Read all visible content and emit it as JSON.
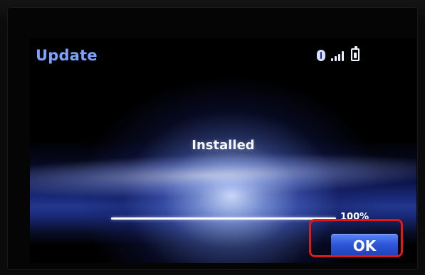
{
  "screen": {
    "title": "Update",
    "status": {
      "bluetooth_icon": "bluetooth-icon",
      "signal_icon": "signal-strength-icon",
      "battery_icon": "battery-icon"
    },
    "message": "Installed",
    "progress": {
      "value": 100,
      "label": "100%"
    },
    "actions": {
      "ok_label": "OK"
    }
  },
  "colors": {
    "title": "#7fa0ff",
    "button_top": "#5c86ff",
    "button_bottom": "#1e3fb6",
    "highlight": "#e01818"
  }
}
